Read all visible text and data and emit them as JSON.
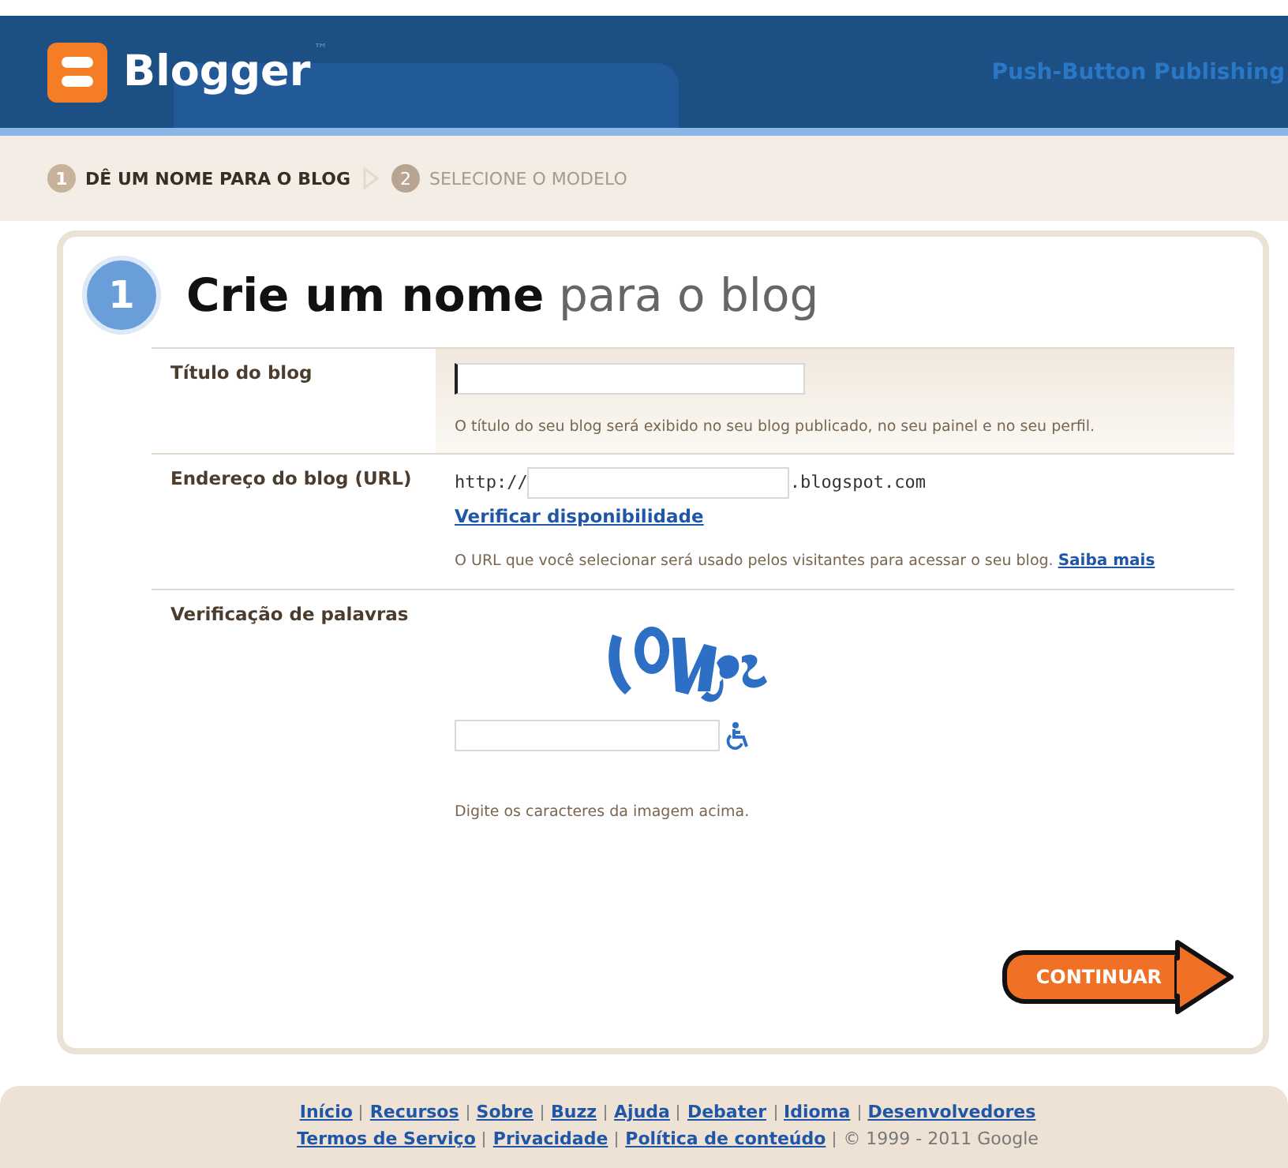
{
  "header": {
    "logo_text": "Blogger",
    "logo_mark": "™",
    "tagline": "Push-Button Publishing"
  },
  "steps": [
    {
      "number": "1",
      "label": "DÊ UM NOME PARA O BLOG",
      "selected": true
    },
    {
      "number": "2",
      "label": "SELECIONE O MODELO",
      "selected": false
    }
  ],
  "form": {
    "step_number": "1",
    "title_bold": "Crie um nome",
    "title_rest": "para o blog",
    "rows": [
      {
        "kind": "title",
        "label": "Título do blog",
        "hint": "O título do seu blog será exibido no seu blog publicado, no seu painel e no seu perfil."
      },
      {
        "kind": "url",
        "label": "Endereço do blog (URL)",
        "prefix": "http://",
        "suffix": ".blogspot.com",
        "link": "Verificar disponibilidade",
        "hint": "O URL que você selecionar será usado pelos visitantes para acessar o seu blog.",
        "hint_link": "Saiba mais"
      },
      {
        "kind": "captcha",
        "label": "Verificação de palavras",
        "hint": "Digite os caracteres da imagem acima."
      }
    ],
    "continue_button": "CONTINUAR"
  },
  "footer": {
    "links": [
      [
        "Início",
        "Recursos",
        "Sobre",
        "Buzz",
        "Ajuda",
        "Debater",
        "Idioma",
        "Desenvolvedores"
      ],
      [
        "Termos de Serviço",
        "Privacidade",
        "Política de conteúdo"
      ]
    ],
    "copyright": "© 1999 - 2011 Google"
  }
}
